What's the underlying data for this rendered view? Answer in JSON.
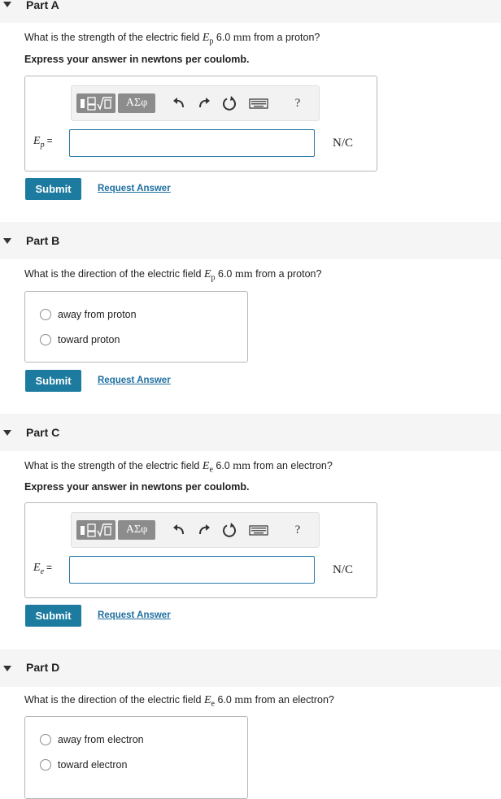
{
  "parts": {
    "a": {
      "title": "Part A",
      "question_pre": "What is the strength of the electric field",
      "symbol": "E",
      "subscript": "p",
      "distance": "6.0",
      "unit_mm": "mm",
      "question_post": "from a proton?",
      "instruction": "Express your answer in newtons per coulomb.",
      "answer_value": "",
      "answer_unit": "N/C",
      "submit_label": "Submit",
      "request_label": "Request Answer"
    },
    "b": {
      "title": "Part B",
      "question_pre": "What is the direction of the electric field",
      "symbol": "E",
      "subscript": "p",
      "distance": "6.0",
      "unit_mm": "mm",
      "question_post": "from a proton?",
      "options": [
        "away from proton",
        "toward proton"
      ],
      "submit_label": "Submit",
      "request_label": "Request Answer"
    },
    "c": {
      "title": "Part C",
      "question_pre": "What is the strength of the electric field",
      "symbol": "E",
      "subscript": "e",
      "distance": "6.0",
      "unit_mm": "mm",
      "question_post": "from an electron?",
      "instruction": "Express your answer in newtons per coulomb.",
      "answer_value": "",
      "answer_unit": "N/C",
      "submit_label": "Submit",
      "request_label": "Request Answer"
    },
    "d": {
      "title": "Part D",
      "question_pre": "What is the direction of the electric field",
      "symbol": "E",
      "subscript": "e",
      "distance": "6.0",
      "unit_mm": "mm",
      "question_post": "from an electron?",
      "options": [
        "away from electron",
        "toward electron"
      ]
    }
  },
  "toolbar": {
    "greek_label": "ΑΣφ",
    "help_label": "?",
    "equals": "="
  },
  "icons": [
    "templates-icon",
    "greek-letters-icon",
    "undo-icon",
    "redo-icon",
    "reset-icon",
    "keyboard-icon",
    "help-icon"
  ],
  "colors": {
    "accent": "#1d7ba0",
    "link": "#1d6ea0",
    "input_border": "#2a7aa8"
  }
}
